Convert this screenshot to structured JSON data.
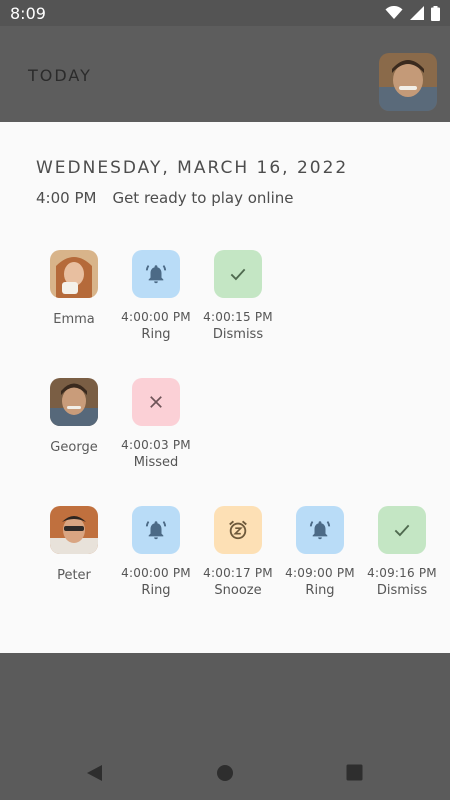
{
  "status_bar": {
    "time": "8:09",
    "icons": [
      "wifi-icon",
      "signal-icon",
      "battery-icon"
    ]
  },
  "app_bar": {
    "title": "TODAY",
    "avatar": "avatar-george"
  },
  "sheet": {
    "date": "WEDNESDAY, MARCH 16, 2022",
    "event_time": "4:00 PM",
    "event_title": "Get ready to play online",
    "rows": [
      {
        "name": "Emma",
        "events": [
          {
            "time": "4:00:00 PM",
            "label": "Ring",
            "icon": "bell-icon"
          },
          {
            "time": "4:00:15 PM",
            "label": "Dismiss",
            "icon": "check-icon"
          }
        ]
      },
      {
        "name": "George",
        "events": [
          {
            "time": "4:00:03 PM",
            "label": "Missed",
            "icon": "close-icon"
          }
        ]
      },
      {
        "name": "Peter",
        "events": [
          {
            "time": "4:00:00 PM",
            "label": "Ring",
            "icon": "bell-icon"
          },
          {
            "time": "4:00:17 PM",
            "label": "Snooze",
            "icon": "snooze-alarm-icon"
          },
          {
            "time": "4:09:00 PM",
            "label": "Ring",
            "icon": "bell-icon"
          },
          {
            "time": "4:09:16 PM",
            "label": "Dismiss",
            "icon": "check-icon"
          }
        ]
      }
    ]
  },
  "colors": {
    "ring": "#b9dcf7",
    "dismiss": "#c4e6c4",
    "missed": "#fbd0d6",
    "snooze": "#fde0b5",
    "scrim": "#5b5b5b",
    "sheet": "#fafafa"
  },
  "nav_bar": {
    "buttons": [
      "back-icon",
      "home-icon",
      "recents-icon"
    ]
  }
}
